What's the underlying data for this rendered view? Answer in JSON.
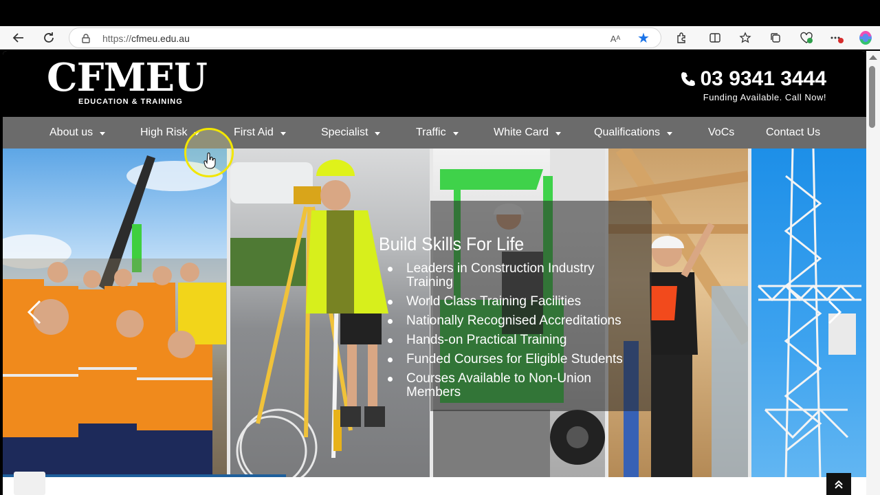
{
  "browser": {
    "url_prefix": "https://",
    "url_domain": "cfmeu.edu.au",
    "read_aloud_label": "Aᴬ"
  },
  "site": {
    "logo_text": "CFMEU",
    "logo_sub": "EDUCATION & TRAINING",
    "phone": "03 9341 3444",
    "phone_tag": "Funding Available. Call Now!"
  },
  "nav": [
    {
      "label": "About us",
      "dropdown": true
    },
    {
      "label": "High Risk",
      "dropdown": true
    },
    {
      "label": "First Aid",
      "dropdown": true
    },
    {
      "label": "Specialist",
      "dropdown": true
    },
    {
      "label": "Traffic",
      "dropdown": true
    },
    {
      "label": "White Card",
      "dropdown": true
    },
    {
      "label": "Qualifications",
      "dropdown": true
    },
    {
      "label": "VoCs",
      "dropdown": false
    },
    {
      "label": "Contact Us",
      "dropdown": false
    }
  ],
  "hero": {
    "title": "Build Skills For Life",
    "bullets": [
      "Leaders in Construction Industry Training",
      "World Class Training Facilities",
      "Nationally Recognised Accreditations",
      "Hands-on Practical Training",
      "Funded Courses for Eligible Students",
      "Courses Available to Non-Union Members"
    ]
  },
  "colors": {
    "header_bg": "#000000",
    "nav_bg": "#6b6b6b",
    "accent_blue": "#1d5f9c",
    "hi_vis_yellow": "#d7ef1c",
    "hi_vis_orange": "#f07a12"
  }
}
